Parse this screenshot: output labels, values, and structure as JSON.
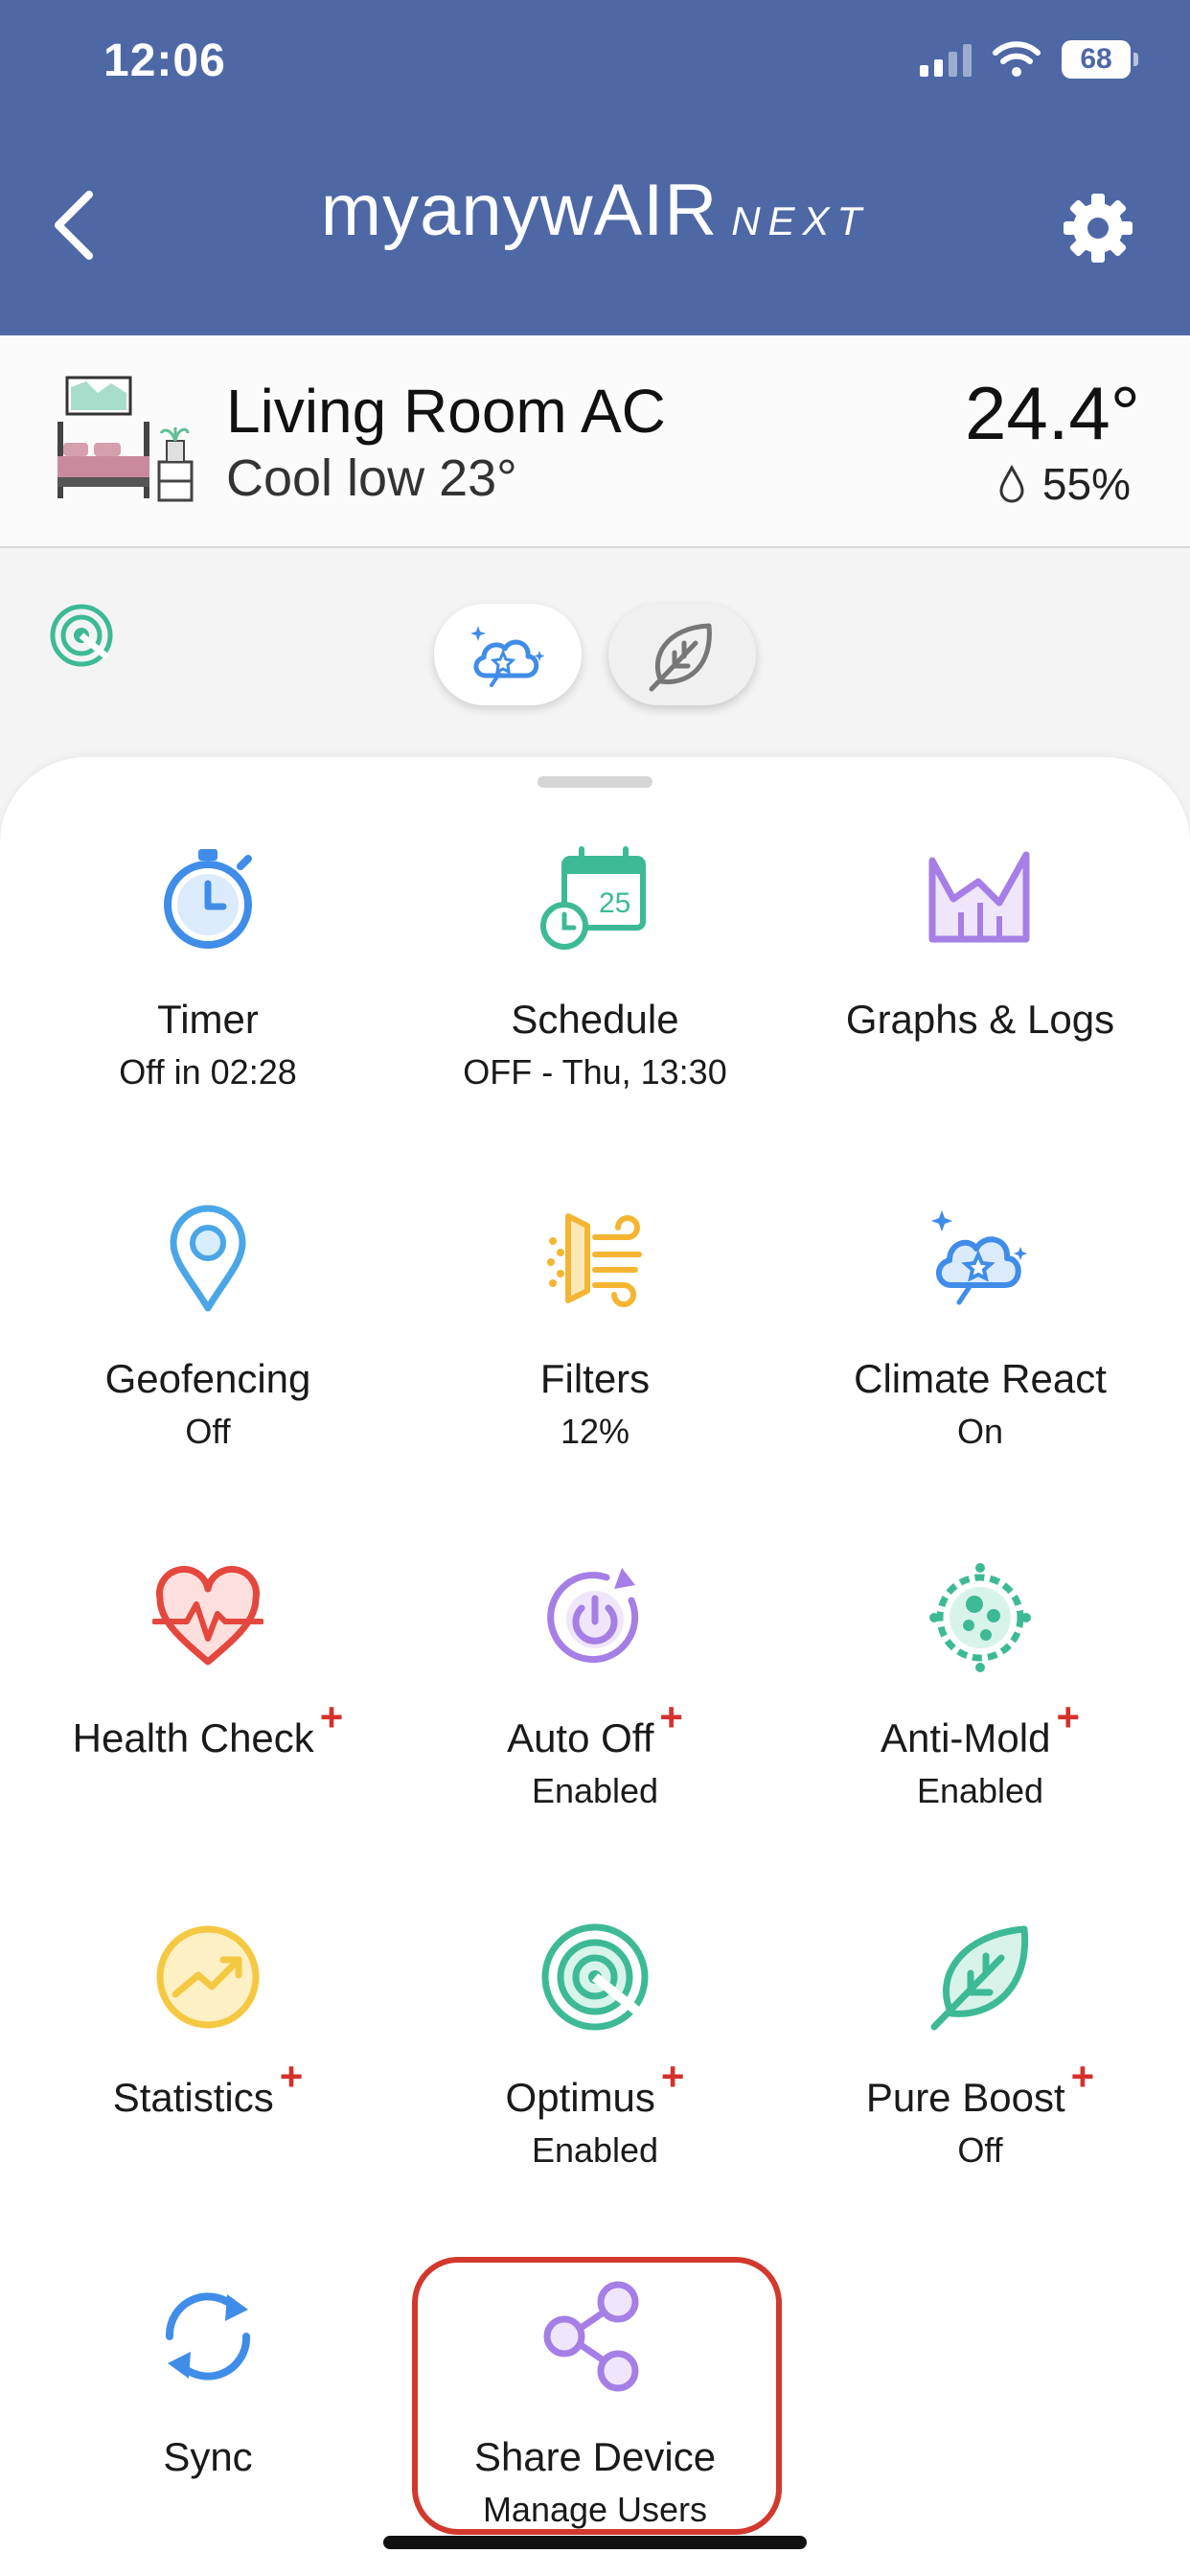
{
  "status_bar": {
    "time": "12:06",
    "battery": "68"
  },
  "header": {
    "brand": "myanywAIR",
    "brand_suffix": "NEXT"
  },
  "device": {
    "name": "Living Room AC",
    "mode": "Cool low 23°",
    "temperature": "24.4°",
    "humidity": "55%"
  },
  "tiles": [
    {
      "title": "Timer",
      "subtitle": "Off in 02:28",
      "icon": "timer-icon",
      "premium": false
    },
    {
      "title": "Schedule",
      "subtitle": "OFF - Thu, 13:30",
      "icon": "calendar-icon",
      "premium": false
    },
    {
      "title": "Graphs & Logs",
      "subtitle": "",
      "icon": "graph-icon",
      "premium": false
    },
    {
      "title": "Geofencing",
      "subtitle": "Off",
      "icon": "location-pin-icon",
      "premium": false
    },
    {
      "title": "Filters",
      "subtitle": "12%",
      "icon": "filter-icon",
      "premium": false
    },
    {
      "title": "Climate React",
      "subtitle": "On",
      "icon": "climate-react-icon",
      "premium": false
    },
    {
      "title": "Health Check",
      "subtitle": "",
      "icon": "heart-pulse-icon",
      "premium": true
    },
    {
      "title": "Auto Off",
      "subtitle": "Enabled",
      "icon": "power-icon",
      "premium": true
    },
    {
      "title": "Anti-Mold",
      "subtitle": "Enabled",
      "icon": "mold-icon",
      "premium": true
    },
    {
      "title": "Statistics",
      "subtitle": "",
      "icon": "trend-icon",
      "premium": true
    },
    {
      "title": "Optimus",
      "subtitle": "Enabled",
      "icon": "optimus-icon",
      "premium": true
    },
    {
      "title": "Pure Boost",
      "subtitle": "Off",
      "icon": "leaf-icon",
      "premium": true
    },
    {
      "title": "Sync",
      "subtitle": "",
      "icon": "sync-icon",
      "premium": false
    },
    {
      "title": "Share Device",
      "subtitle": "Manage Users",
      "icon": "share-icon",
      "premium": false
    }
  ],
  "premium_marker": "+",
  "colors": {
    "header": "#4e68a6",
    "premium": "#d5312c",
    "highlight": "#d2392c",
    "blue": "#3f8de8",
    "green": "#3dba95",
    "purple": "#a57ee6",
    "orange": "#f5b533",
    "red": "#e4473d"
  }
}
